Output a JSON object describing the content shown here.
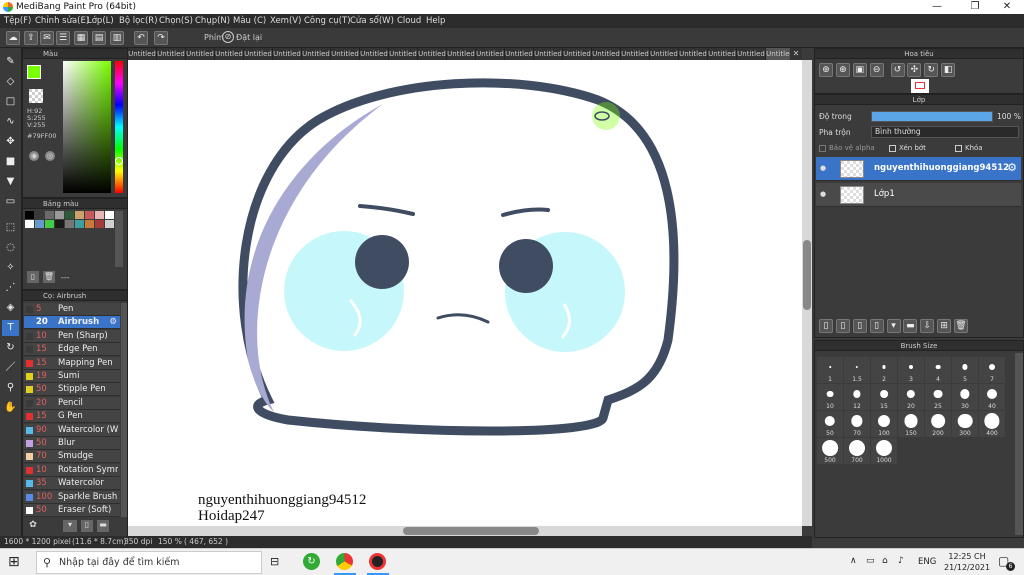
{
  "window": {
    "title": "MediBang Paint Pro (64bit)"
  },
  "menu": [
    "Tệp(F)",
    "Chỉnh sửa(E)",
    "Lớp(L)",
    "Bộ lọc(R)",
    "Chọn(S)",
    "Chụp(N)",
    "Màu (C)",
    "Xem(V)",
    "Công cụ(T)",
    "Cửa sổ(W)",
    "Cloud",
    "Help"
  ],
  "toolbar": {
    "key_label": "Phím",
    "reset_label": "Đặt lại"
  },
  "color_panel": {
    "title": "Màu",
    "h": "H:92",
    "s": "S:255",
    "v": "V:255",
    "hex": "#79FF00",
    "fg_color": "#79FF00"
  },
  "palette_panel": {
    "title": "Bảng màu",
    "name": "---",
    "colors": [
      "#000000",
      "#3a3a3a",
      "#6a6a6a",
      "#9a9a9a",
      "#2e5c3a",
      "#c9a36b",
      "#c45a5a",
      "#e8b5b5",
      "#ffffff",
      "#ffffff",
      "#6699cc",
      "#44cc44",
      "#1a1a1a",
      "#777777",
      "#3aa0a0",
      "#c87a3a",
      "#a83a3a",
      "#d0d0d0"
    ]
  },
  "brush_panel": {
    "title": "Cọ: Airbrush",
    "items": [
      {
        "size": "5",
        "name": "Pen",
        "color": "#3a3a3a"
      },
      {
        "size": "20",
        "name": "Airbrush",
        "color": "#3a74c8",
        "selected": true
      },
      {
        "size": "10",
        "name": "Pen (Sharp)",
        "color": "#3a3a3a"
      },
      {
        "size": "15",
        "name": "Edge Pen",
        "color": "#3a3a3a"
      },
      {
        "size": "15",
        "name": "Mapping Pen",
        "color": "#e03030"
      },
      {
        "size": "19",
        "name": "Sumi",
        "color": "#e0d020"
      },
      {
        "size": "50",
        "name": "Stipple Pen",
        "color": "#e0d020"
      },
      {
        "size": "20",
        "name": "Pencil",
        "color": "#3a3a3a"
      },
      {
        "size": "15",
        "name": "G Pen",
        "color": "#e03030"
      },
      {
        "size": "90",
        "name": "Watercolor (We",
        "color": "#5ab8e8"
      },
      {
        "size": "50",
        "name": "Blur",
        "color": "#c0a0e0"
      },
      {
        "size": "70",
        "name": "Smudge",
        "color": "#f0d0a0"
      },
      {
        "size": "10",
        "name": "Rotation Symm",
        "color": "#e03030"
      },
      {
        "size": "35",
        "name": "Watercolor",
        "color": "#5ab8e8"
      },
      {
        "size": "100",
        "name": "Sparkle Brush",
        "color": "#5a8ae8"
      },
      {
        "size": "50",
        "name": "Eraser (Soft)",
        "color": "#ffffff"
      }
    ]
  },
  "tabs": [
    "Untitled",
    "Untitled",
    "Untitled",
    "Untitled",
    "Untitled",
    "Untitled",
    "Untitled",
    "Untitled",
    "Untitled",
    "Untitled",
    "Untitled",
    "Untitled",
    "Untitled",
    "Untitled",
    "Untitled",
    "Untitled",
    "Untitled",
    "Untitled",
    "Untitled",
    "Untitled",
    "Untitled",
    "Untitled",
    "Untitled"
  ],
  "canvas_text": {
    "line1": "nguyenthihuonggiang94512",
    "line2": "Hoidap247"
  },
  "status": {
    "dimensions": "1600 * 1200 pixel",
    "physical": "(11.6 * 8.7cm)",
    "dpi": "350 dpi",
    "zoom": "150 %",
    "coords": "( 467, 652 )"
  },
  "navigator": {
    "title": "Hoa tiêu"
  },
  "layer_panel": {
    "title": "Lớp",
    "opacity_label": "Độ trong",
    "opacity_value": "100 %",
    "opacity": 100,
    "blend_label": "Pha trộn",
    "blend_value": "Bình thường",
    "protect_alpha": "Bảo vệ alpha",
    "clipping": "Xén bớt",
    "lock": "Khóa",
    "layers": [
      {
        "name": "nguyenthihuonggiang94512",
        "selected": true
      },
      {
        "name": "Lớp1",
        "selected": false
      }
    ]
  },
  "brush_size_panel": {
    "title": "Brush Size",
    "sizes": [
      "1",
      "1.5",
      "2",
      "3",
      "4",
      "5",
      "7",
      "10",
      "12",
      "15",
      "20",
      "25",
      "30",
      "40",
      "50",
      "70",
      "100",
      "150",
      "200",
      "300",
      "400",
      "500",
      "700",
      "1000"
    ]
  },
  "taskbar": {
    "search_placeholder": "Nhập tại đây để tìm kiếm",
    "time": "12:25 CH",
    "date": "21/12/2021",
    "lang": "ENG",
    "notif_count": "6"
  }
}
